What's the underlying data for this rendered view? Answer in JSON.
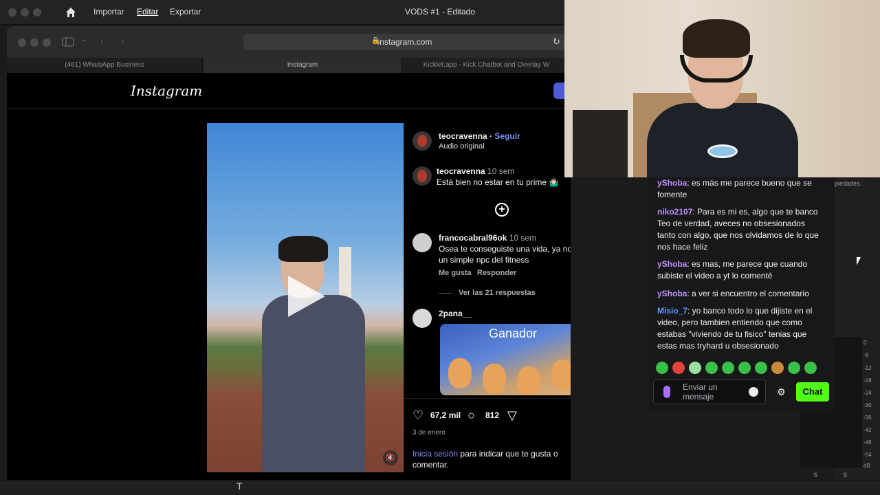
{
  "editor": {
    "menu": [
      "Importar",
      "Editar",
      "Exportar"
    ],
    "title": "VODS #1 - Editado"
  },
  "browser": {
    "url": "instagram.com",
    "tabs": [
      "(461) WhatsApp Business",
      "Instagram",
      "Kicklet.app - Kick Chatbot and Overlay W"
    ]
  },
  "instagram": {
    "logo": "Instagram",
    "post": {
      "author": "teocravenna",
      "follow": "Seguir",
      "audio": "Audio original",
      "caption_author": "teocravenna",
      "caption_time": "10 sem",
      "caption": "Está bien no estar en tu prime 🤷🏻‍♂️"
    },
    "comments": [
      {
        "user": "francocabral96ok",
        "time": "10 sem",
        "text": "Osea te conseguiste una vida, ya no sos un simple npc del fitness",
        "like": "Me gusta",
        "reply": "Responder",
        "view_replies": "Ver las 21 respuestas"
      },
      {
        "user": "2pana__",
        "gif_caption": "Ganador"
      }
    ],
    "actions": {
      "likes": "67,2 mil",
      "comments": "812",
      "date": "3 de enero",
      "login_link": "Inicia sesión",
      "login_text": "para indicar que te gusta o comentar."
    }
  },
  "chat": {
    "messages": [
      {
        "user": "yShoba",
        "text": ": es más me parece bueno que se fomente",
        "color": "#bf94ff"
      },
      {
        "user": "niko2107",
        "text": ": Para es mi es, algo que te banco Teo de verdad, aveces no obsesionados tanto con algo, que nos olvidamos de lo que nos hace feliz",
        "color": "#bf94ff"
      },
      {
        "user": "yShoba",
        "text": ": es mas, me parece que cuando subiste el video a yt lo comenté",
        "color": "#bf94ff"
      },
      {
        "user": "yShoba",
        "text": ": a ver si encuentro el comentario",
        "color": "#bf94ff"
      },
      {
        "user": "Misio_7",
        "text": ": yo banco todo lo que dijiste en el video, pero tambien entiendo que como estabas \"viviendo de tu fisico\" tenias que estas mas tryhard u obsesionado",
        "color": "#5c9bff"
      }
    ],
    "input_placeholder": "Enviar un mensaje",
    "send_label": "Chat",
    "accent": "#53fc18"
  },
  "side": {
    "note": "piedades.",
    "db_labels": [
      "0",
      "-6",
      "-12",
      "-18",
      "-24",
      "-30",
      "-36",
      "-42",
      "-48",
      "-54",
      "dB"
    ],
    "s_labels": [
      "S",
      "S"
    ]
  }
}
